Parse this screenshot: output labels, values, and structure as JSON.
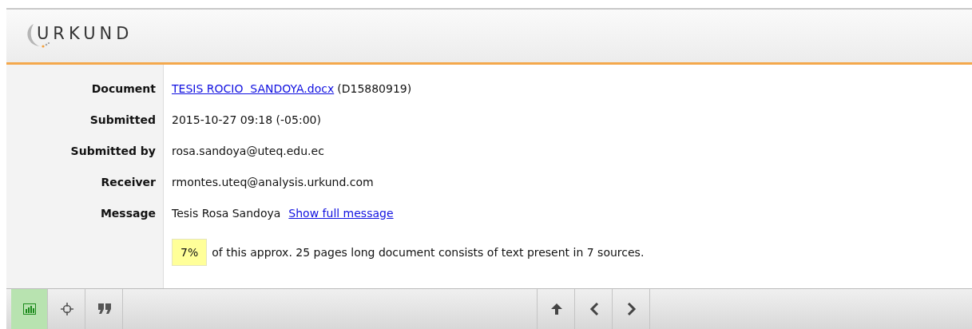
{
  "header": {
    "logo": "URKUND"
  },
  "details": [
    {
      "label": "Document",
      "kind": "document",
      "link": "TESIS ROCIO  SANDOYA.docx",
      "value": "(D15880919)"
    },
    {
      "label": "Submitted",
      "kind": "text",
      "value": "2015-10-27 09:18 (-05:00)"
    },
    {
      "label": "Submitted by",
      "kind": "text",
      "value": "rosa.sandoya@uteq.edu.ec"
    },
    {
      "label": "Receiver",
      "kind": "text",
      "value": "rmontes.uteq@analysis.urkund.com"
    },
    {
      "label": "Message",
      "kind": "message",
      "value": "Tesis Rosa Sandoya",
      "link": "Show full message"
    }
  ],
  "summary": {
    "percent": "7%",
    "text": "of this approx. 25 pages long document consists of text present in 7 sources."
  },
  "toolbar": {
    "left": [
      {
        "kind": "chart",
        "selected": true
      },
      {
        "kind": "target",
        "selected": false
      },
      {
        "kind": "quote",
        "selected": false
      }
    ],
    "right": [
      {
        "kind": "up"
      },
      {
        "kind": "prev"
      },
      {
        "kind": "next"
      }
    ]
  }
}
